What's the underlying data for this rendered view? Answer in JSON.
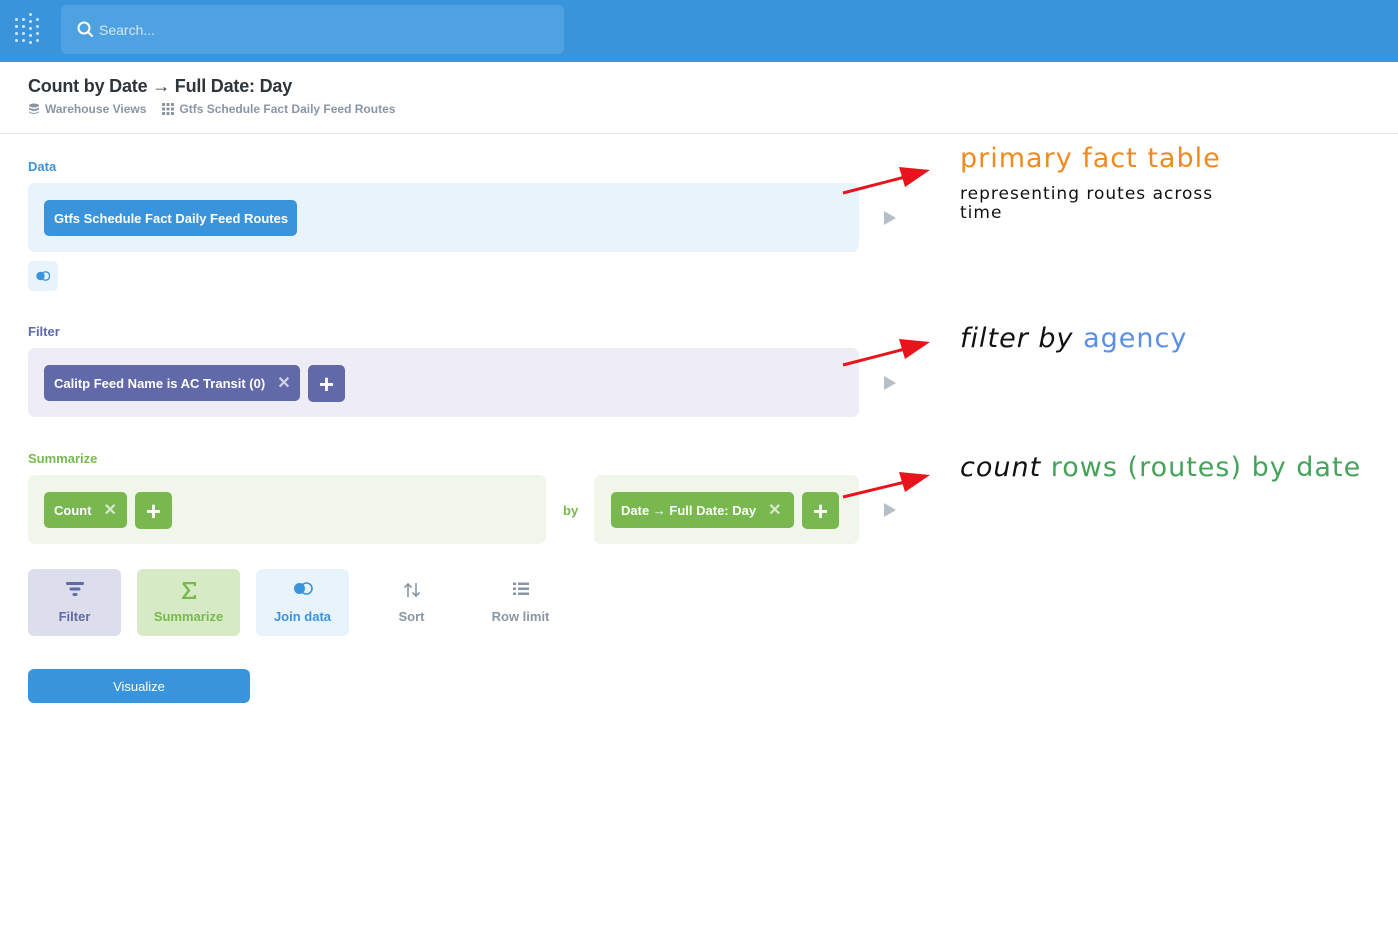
{
  "nav": {
    "search_placeholder": "Search..."
  },
  "header": {
    "title": "Count by Date → Full Date: Day",
    "breadcrumb": [
      "Warehouse Views",
      "Gtfs Schedule Fact Daily Feed Routes"
    ]
  },
  "data_section": {
    "label": "Data",
    "table": "Gtfs Schedule Fact Daily Feed Routes"
  },
  "filter_section": {
    "label": "Filter",
    "filters": [
      "Calitp Feed Name is AC Transit (0)"
    ]
  },
  "summarize_section": {
    "label": "Summarize",
    "metrics": [
      "Count"
    ],
    "by_label": "by",
    "breakouts": [
      "Date → Full Date: Day"
    ]
  },
  "actions": {
    "filter": "Filter",
    "summarize": "Summarize",
    "join": "Join data",
    "sort": "Sort",
    "row_limit": "Row limit"
  },
  "visualize_label": "Visualize",
  "annotations": {
    "a1_title": "primary fact table",
    "a1_body": "representing routes across time",
    "a2_part1": "filter by",
    "a2_part2": "agency",
    "a3_part1": "count",
    "a3_part2": "rows (routes) by date"
  },
  "colors": {
    "nav": "#3a94dc",
    "data": "#3a94dc",
    "filter": "#6169a8",
    "summarize": "#78b84f",
    "annotation_orange": "#ef8a1f",
    "annotation_blue": "#5b8ee6",
    "annotation_green": "#45a35a",
    "arrow": "#e8141c"
  }
}
